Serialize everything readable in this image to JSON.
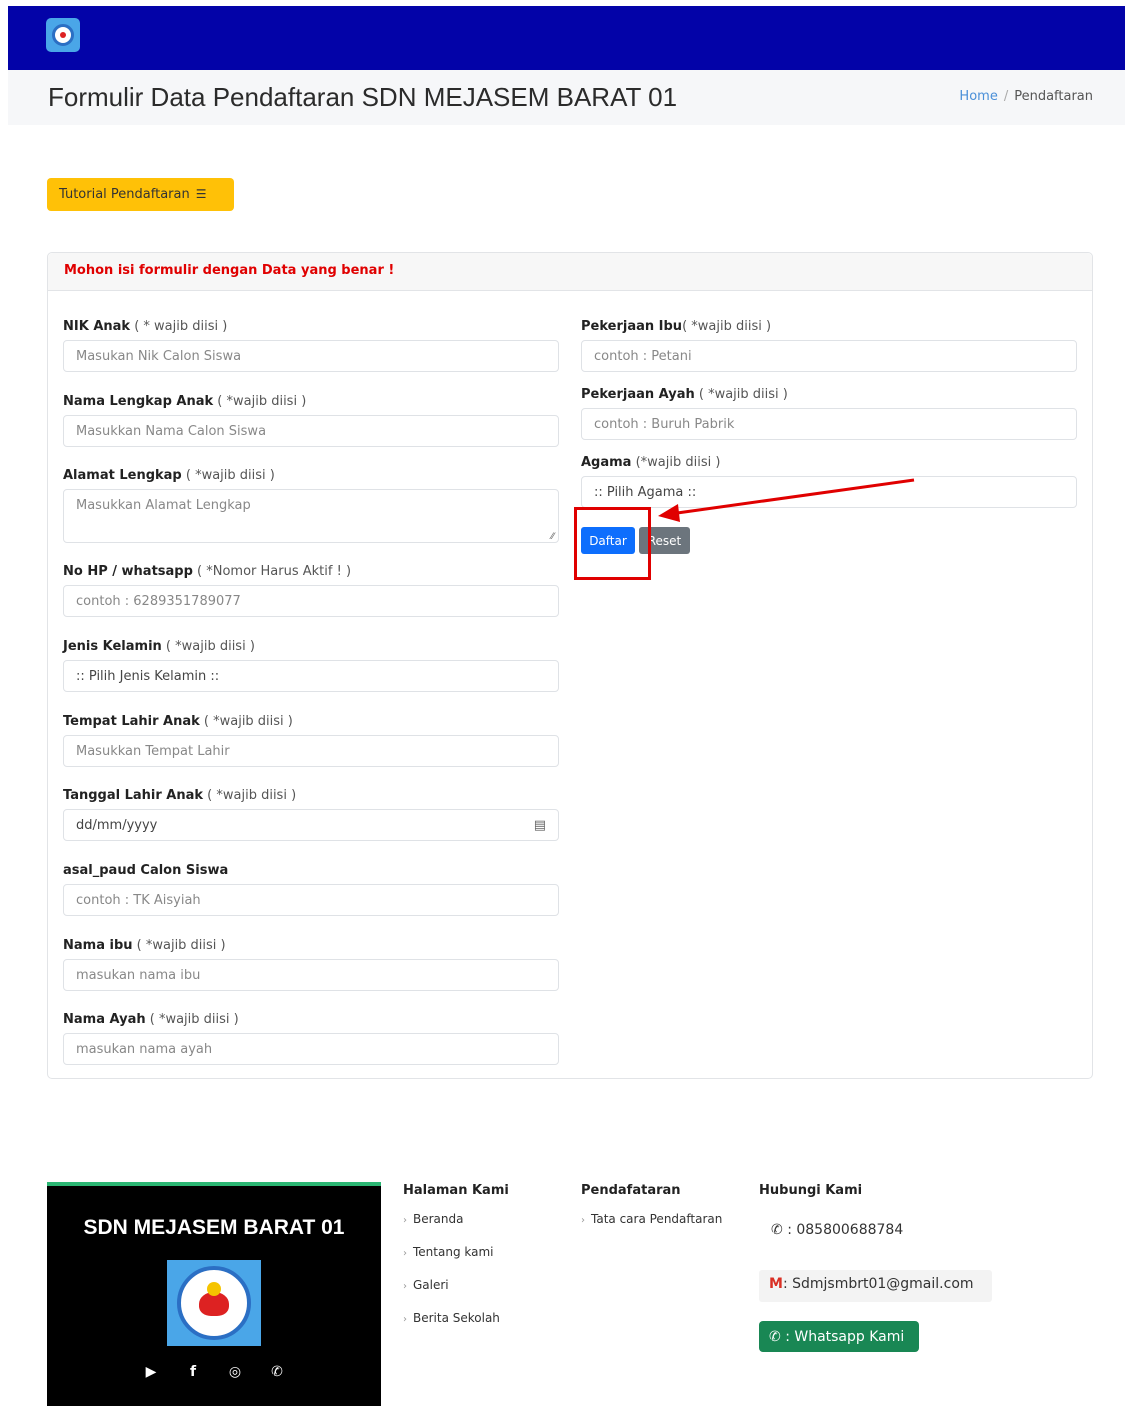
{
  "header": {
    "title": "Formulir Data Pendaftaran SDN MEJASEM BARAT 01"
  },
  "breadcrumb": {
    "home": "Home",
    "separator": "/",
    "current": "Pendaftaran"
  },
  "tutorial_button": {
    "label": "Tutorial Pendaftaran",
    "icon": "list-icon"
  },
  "form": {
    "header_notice": "Mohon isi formulir dengan Data yang benar !",
    "left_fields": [
      {
        "label": "NIK Anak",
        "note": " ( * wajib diisi )",
        "placeholder": "Masukan Nik Calon Siswa"
      },
      {
        "label": "Nama Lengkap Anak",
        "note": " ( *wajib diisi )",
        "placeholder": "Masukkan Nama Calon Siswa"
      },
      {
        "label": "Alamat Lengkap",
        "note": " ( *wajib diisi )",
        "placeholder": "Masukkan Alamat Lengkap"
      },
      {
        "label": "No HP / whatsapp",
        "note": " ( *Nomor Harus Aktif ! )",
        "placeholder": "contoh : 6289351789077"
      },
      {
        "label": "Jenis Kelamin",
        "note": " ( *wajib diisi )",
        "placeholder": ":: Pilih Jenis Kelamin ::"
      },
      {
        "label": "Tempat Lahir Anak",
        "note": " ( *wajib diisi )",
        "placeholder": "Masukkan Tempat Lahir"
      },
      {
        "label": "Tanggal Lahir Anak",
        "note": " ( *wajib diisi )",
        "placeholder": "dd/mm/yyyy"
      },
      {
        "label": "asal_paud Calon Siswa",
        "note": "",
        "placeholder": "contoh : TK Aisyiah"
      },
      {
        "label": "Nama ibu",
        "note": " ( *wajib diisi )",
        "placeholder": "masukan nama ibu"
      },
      {
        "label": "Nama Ayah",
        "note": " ( *wajib diisi )",
        "placeholder": "masukan nama ayah"
      }
    ],
    "right_fields": [
      {
        "label": "Pekerjaan Ibu",
        "note": "( *wajib diisi )",
        "placeholder": "contoh : Petani"
      },
      {
        "label": "Pekerjaan Ayah",
        "note": " ( *wajib diisi )",
        "placeholder": "contoh : Buruh Pabrik"
      },
      {
        "label": "Agama",
        "note": " (*wajib diisi )",
        "placeholder": ":: Pilih Agama ::"
      }
    ],
    "submit_label": "Daftar",
    "reset_label": "Reset"
  },
  "annotation": {
    "color": "#e00000"
  },
  "footer": {
    "school_name": "SDN MEJASEM BARAT 01",
    "social_icons": [
      "youtube-icon",
      "facebook-icon",
      "instagram-icon",
      "whatsapp-icon"
    ],
    "halaman": {
      "title": "Halaman Kami",
      "links": [
        "Beranda",
        "Tentang kami",
        "Galeri",
        "Berita Sekolah"
      ]
    },
    "pendaftaran": {
      "title": "Pendafataran",
      "links": [
        "Tata cara Pendaftaran"
      ]
    },
    "hubungi": {
      "title": "Hubungi Kami",
      "phone": ": 085800688784",
      "email": ": Sdmjsmbrt01@gmail.com",
      "whatsapp": ": Whatsapp Kami"
    }
  },
  "colors": {
    "navbar": "#0303a8",
    "tutorial": "#ffc107",
    "daftar": "#0d6efd",
    "reset": "#6c757d",
    "whatsapp": "#198754"
  }
}
